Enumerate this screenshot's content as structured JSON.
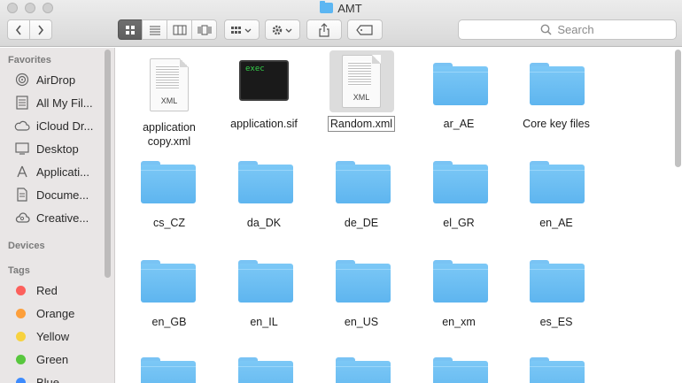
{
  "window": {
    "title": "AMT"
  },
  "toolbar": {
    "back_label": "‹",
    "forward_label": "›",
    "search_placeholder": "Search"
  },
  "sidebar": {
    "favorites_header": "Favorites",
    "favorites": [
      {
        "label": "AirDrop",
        "icon": "airdrop-icon"
      },
      {
        "label": "All My Fil...",
        "icon": "all-my-files-icon"
      },
      {
        "label": "iCloud Dr...",
        "icon": "icloud-icon"
      },
      {
        "label": "Desktop",
        "icon": "desktop-icon"
      },
      {
        "label": "Applicati...",
        "icon": "applications-icon"
      },
      {
        "label": "Docume...",
        "icon": "documents-icon"
      },
      {
        "label": "Creative...",
        "icon": "creative-cloud-icon"
      }
    ],
    "devices_header": "Devices",
    "tags_header": "Tags",
    "tags": [
      {
        "label": "Red",
        "color": "#fc605c"
      },
      {
        "label": "Orange",
        "color": "#fd9f3b"
      },
      {
        "label": "Yellow",
        "color": "#f7d23f"
      },
      {
        "label": "Green",
        "color": "#58c73e"
      },
      {
        "label": "Blue",
        "color": "#3d8bfd"
      }
    ]
  },
  "files": [
    {
      "name": "application copy.xml",
      "name_line1": "application",
      "name_line2": "copy.xml",
      "kind": "xml",
      "ext": "XML"
    },
    {
      "name": "application.sif",
      "kind": "exec",
      "icon_text": "exec"
    },
    {
      "name": "Random.xml",
      "kind": "xml",
      "ext": "XML",
      "selected": true
    },
    {
      "name": "ar_AE",
      "kind": "folder"
    },
    {
      "name": "Core key files",
      "kind": "folder"
    },
    {
      "name": "cs_CZ",
      "kind": "folder"
    },
    {
      "name": "da_DK",
      "kind": "folder"
    },
    {
      "name": "de_DE",
      "kind": "folder"
    },
    {
      "name": "el_GR",
      "kind": "folder"
    },
    {
      "name": "en_AE",
      "kind": "folder"
    },
    {
      "name": "en_GB",
      "kind": "folder"
    },
    {
      "name": "en_IL",
      "kind": "folder"
    },
    {
      "name": "en_US",
      "kind": "folder"
    },
    {
      "name": "en_xm",
      "kind": "folder"
    },
    {
      "name": "es_ES",
      "kind": "folder"
    }
  ]
}
